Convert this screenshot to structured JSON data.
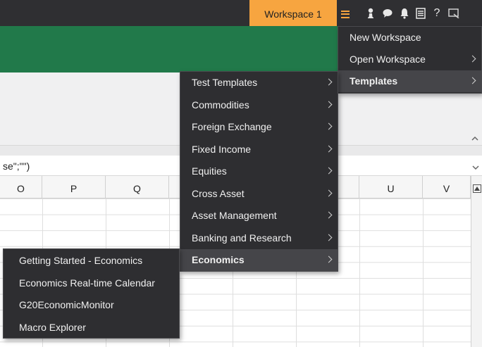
{
  "topbar": {
    "workspace_tab": "Workspace 1",
    "icons": [
      "menu-icon",
      "user-icon",
      "chat-icon",
      "bell-icon",
      "list-icon",
      "help-icon",
      "screen-icon"
    ],
    "help_glyph": "?"
  },
  "colors": {
    "topbar_bg": "#2f2f32",
    "workspace_tab_bg": "#f7a540",
    "ribbon_green": "#21794a",
    "menu_bg": "#2e2e31",
    "menu_highlight": "#454549",
    "menu_text": "#f0f0f0"
  },
  "formula_bar": {
    "text": "se\";\"\")"
  },
  "spreadsheet": {
    "columns": [
      "O",
      "P",
      "Q",
      "U",
      "V"
    ]
  },
  "main_menu": {
    "items": [
      {
        "label": "New Workspace",
        "has_submenu": false,
        "highlighted": false
      },
      {
        "label": "Open Workspace",
        "has_submenu": true,
        "highlighted": false
      },
      {
        "label": "Templates",
        "has_submenu": true,
        "highlighted": true
      }
    ]
  },
  "templates_menu": {
    "items": [
      {
        "label": "Test Templates",
        "has_submenu": true,
        "highlighted": false
      },
      {
        "label": "Commodities",
        "has_submenu": true,
        "highlighted": false
      },
      {
        "label": "Foreign Exchange",
        "has_submenu": true,
        "highlighted": false
      },
      {
        "label": "Fixed Income",
        "has_submenu": true,
        "highlighted": false
      },
      {
        "label": "Equities",
        "has_submenu": true,
        "highlighted": false
      },
      {
        "label": "Cross Asset",
        "has_submenu": true,
        "highlighted": false
      },
      {
        "label": "Asset Management",
        "has_submenu": true,
        "highlighted": false
      },
      {
        "label": "Banking and Research",
        "has_submenu": true,
        "highlighted": false
      },
      {
        "label": "Economics",
        "has_submenu": true,
        "highlighted": true
      }
    ]
  },
  "economics_menu": {
    "items": [
      {
        "label": "Getting Started - Economics"
      },
      {
        "label": "Economics Real-time Calendar"
      },
      {
        "label": "G20EconomicMonitor"
      },
      {
        "label": "Macro Explorer"
      }
    ]
  }
}
